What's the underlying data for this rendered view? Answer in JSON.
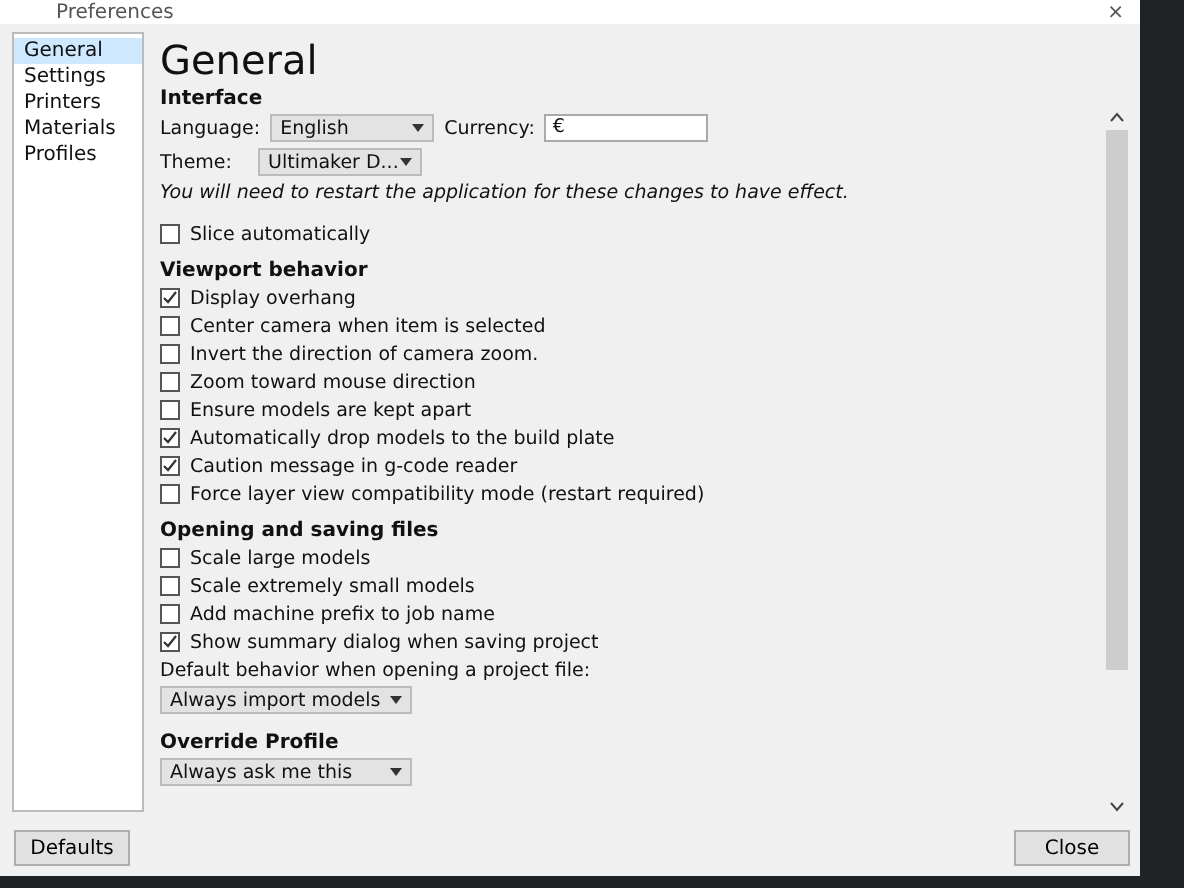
{
  "window": {
    "title": "Preferences",
    "close": "×"
  },
  "sidebar": {
    "items": [
      {
        "label": "General",
        "selected": true
      },
      {
        "label": "Settings",
        "selected": false
      },
      {
        "label": "Printers",
        "selected": false
      },
      {
        "label": "Materials",
        "selected": false
      },
      {
        "label": "Profiles",
        "selected": false
      }
    ]
  },
  "page_title": "General",
  "interface": {
    "heading": "Interface",
    "language_label": "Language:",
    "language": "English",
    "currency_label": "Currency:",
    "currency": "€",
    "theme_label": "Theme:",
    "theme": "Ultimaker D...",
    "note": "You will need to restart the application for these changes to have effect.",
    "options": [
      {
        "label": "Slice automatically",
        "checked": false
      }
    ]
  },
  "viewport": {
    "heading": "Viewport behavior",
    "options": [
      {
        "label": "Display overhang",
        "checked": true
      },
      {
        "label": "Center camera when item is selected",
        "checked": false
      },
      {
        "label": "Invert the direction of camera zoom.",
        "checked": false
      },
      {
        "label": "Zoom toward mouse direction",
        "checked": false
      },
      {
        "label": "Ensure models are kept apart",
        "checked": false
      },
      {
        "label": "Automatically drop models to the build plate",
        "checked": true
      },
      {
        "label": "Caution message in g-code reader",
        "checked": true
      },
      {
        "label": "Force layer view compatibility mode (restart required)",
        "checked": false
      }
    ]
  },
  "files": {
    "heading": "Opening and saving files",
    "options": [
      {
        "label": "Scale large models",
        "checked": false
      },
      {
        "label": "Scale extremely small models",
        "checked": false
      },
      {
        "label": "Add machine prefix to job name",
        "checked": false
      },
      {
        "label": "Show summary dialog when saving project",
        "checked": true
      }
    ],
    "project_label": "Default behavior when opening a project file:",
    "project_behavior": "Always import models"
  },
  "override": {
    "heading": "Override Profile",
    "value": "Always ask me this"
  },
  "buttons": {
    "defaults": "Defaults",
    "close": "Close"
  }
}
